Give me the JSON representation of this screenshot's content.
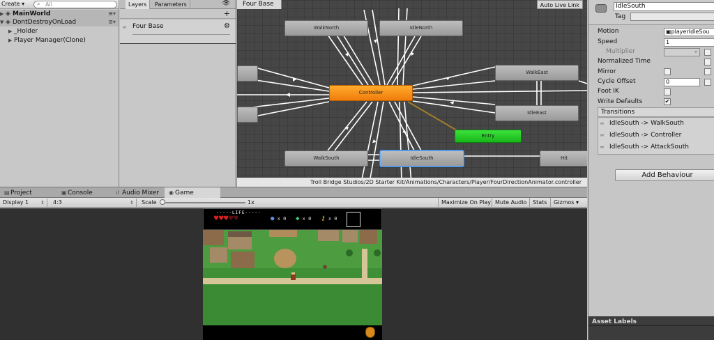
{
  "hierarchy": {
    "create_label": "Create",
    "search_placeholder": "All",
    "rows": [
      {
        "label": "MainWorld",
        "type": "scene"
      },
      {
        "label": "DontDestroyOnLoad",
        "type": "scene"
      },
      {
        "label": "_Holder",
        "type": "object"
      },
      {
        "label": "Player Manager(Clone)",
        "type": "object"
      }
    ]
  },
  "layers_panel": {
    "tabs": [
      "Layers",
      "Parameters"
    ],
    "active_tab": "Layers",
    "layer_name": "Four Base"
  },
  "animator": {
    "breadcrumb": "Four Base",
    "auto_live_link": "Auto Live Link",
    "asset_path": "Troll Bridge Studios/2D Starter Kit/Animations/Characters/Player/FourDirectionAnimator.controller",
    "states": [
      {
        "name": "WalkNorth",
        "style": "gray"
      },
      {
        "name": "IdleNorth",
        "style": "gray"
      },
      {
        "name": "WalkEast",
        "style": "gray"
      },
      {
        "name": "IdleEast",
        "style": "gray"
      },
      {
        "name": "Controller",
        "style": "orange"
      },
      {
        "name": "Entry",
        "style": "green"
      },
      {
        "name": "WalkSouth",
        "style": "gray"
      },
      {
        "name": "IdleSouth",
        "style": "selected"
      },
      {
        "name": "Hit",
        "style": "gray"
      }
    ]
  },
  "inspector": {
    "state_name": "IdleSouth",
    "tag_label": "Tag",
    "props": {
      "motion_label": "Motion",
      "motion_value": "playerIdleSou",
      "speed_label": "Speed",
      "speed_value": "1",
      "multiplier_label": "Multiplier",
      "normalized_time_label": "Normalized Time",
      "mirror_label": "Mirror",
      "cycle_offset_label": "Cycle Offset",
      "cycle_offset_value": "0",
      "foot_ik_label": "Foot IK",
      "write_defaults_label": "Write Defaults",
      "write_defaults_checked": true
    },
    "transitions_header": "Transitions",
    "transitions": [
      "IdleSouth -> WalkSouth",
      "IdleSouth -> Controller",
      "IdleSouth -> AttackSouth"
    ],
    "add_behaviour": "Add Behaviour",
    "asset_labels": "Asset Labels"
  },
  "bottom_tabs": [
    {
      "label": "Project",
      "icon": "folder-icon"
    },
    {
      "label": "Console",
      "icon": "console-icon"
    },
    {
      "label": "Audio Mixer",
      "icon": "mixer-icon"
    },
    {
      "label": "Game",
      "icon": "game-icon",
      "active": true
    }
  ],
  "game_toolbar": {
    "display": "Display 1",
    "aspect": "4:3",
    "scale_label": "Scale",
    "scale_value": "1x",
    "maximize": "Maximize On Play",
    "mute": "Mute Audio",
    "stats": "Stats",
    "gizmos": "Gizmos"
  },
  "game_hud": {
    "life_label": "-----LIFE-----",
    "hearts_full": 3,
    "hearts_total": 5,
    "bombs": "x 0",
    "gems": "x 0",
    "keys": "x 0"
  }
}
